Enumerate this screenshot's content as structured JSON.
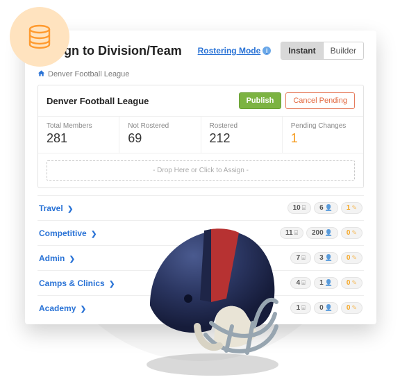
{
  "header": {
    "title": "Assign to Division/Team",
    "mode_link": "Rostering Mode",
    "toggle": {
      "instant": "Instant",
      "builder": "Builder"
    }
  },
  "breadcrumb": {
    "org": "Denver Football League"
  },
  "card": {
    "title": "Denver Football League",
    "publish_label": "Publish",
    "cancel_label": "Cancel Pending",
    "dropzone": "- Drop Here or Click to Assign -"
  },
  "stats": {
    "total": {
      "label": "Total Members",
      "value": "281"
    },
    "notr": {
      "label": "Not Rostered",
      "value": "69"
    },
    "rost": {
      "label": "Rostered",
      "value": "212"
    },
    "pending": {
      "label": "Pending Changes",
      "value": "1"
    }
  },
  "divisions": [
    {
      "name": "Travel",
      "a": "10",
      "b": "6",
      "c": "1"
    },
    {
      "name": "Competitive",
      "a": "11",
      "b": "200",
      "c": "0"
    },
    {
      "name": "Admin",
      "a": "7",
      "b": "3",
      "c": "0"
    },
    {
      "name": "Camps & Clinics",
      "a": "4",
      "b": "1",
      "c": "0"
    },
    {
      "name": "Academy",
      "a": "1",
      "b": "0",
      "c": "0"
    }
  ]
}
